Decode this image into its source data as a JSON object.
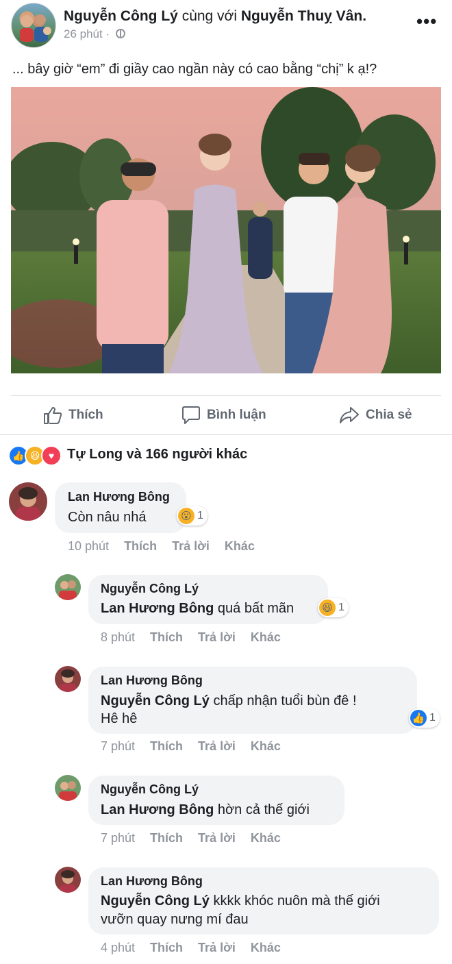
{
  "post": {
    "author": "Nguyễn Công Lý",
    "with_word": "cùng với",
    "tagged": "Nguyễn Thuỵ Vân.",
    "time": "26 phút",
    "privacy_icon": "globe-icon",
    "more_label": "•••",
    "caption": "... bây giờ “em” đi giầy cao ngần này có cao bằng “chị” k ạ!?"
  },
  "actions": {
    "like": "Thích",
    "comment": "Bình luận",
    "share": "Chia sẻ"
  },
  "reactions": {
    "icons": [
      "like-icon",
      "haha-icon",
      "love-icon"
    ],
    "summary": "Tự Long và 166 người khác"
  },
  "comments": [
    {
      "name": "Lan Hương Bông",
      "mention": "",
      "text": "Còn nâu nhá",
      "time": "10 phút",
      "like": "Thích",
      "reply": "Trả lời",
      "more": "Khác",
      "reaction_count": "1",
      "reaction_icon": "wow-icon"
    },
    {
      "name": "Nguyễn Công Lý",
      "mention": "Lan Hương Bông",
      "text": "quá bất mãn",
      "time": "8 phút",
      "like": "Thích",
      "reply": "Trả lời",
      "more": "Khác",
      "reaction_count": "1",
      "reaction_icon": "haha-icon"
    },
    {
      "name": "Lan Hương Bông",
      "mention": "Nguyễn Công Lý",
      "text": "chấp nhận tuổi bùn đê !",
      "text2": "Hê hê",
      "time": "7 phút",
      "like": "Thích",
      "reply": "Trả lời",
      "more": "Khác",
      "reaction_count": "1",
      "reaction_icon": "like-icon"
    },
    {
      "name": "Nguyễn Công Lý",
      "mention": "Lan Hương Bông",
      "text": "hờn cả thế giới",
      "time": "7 phút",
      "like": "Thích",
      "reply": "Trả lời",
      "more": "Khác"
    },
    {
      "name": "Lan Hương Bông",
      "mention": "Nguyễn Công Lý",
      "text": "kkkk khóc nuôn mà thế giới",
      "text2": "vưỡn quay nưng mí đau",
      "time": "4 phút",
      "like": "Thích",
      "reply": "Trả lời",
      "more": "Khác"
    }
  ],
  "colors": {
    "like_blue": "#1877f2",
    "haha_yellow": "#f7b125",
    "love_red": "#f33e58",
    "bubble_gray": "#f2f3f5",
    "meta_gray": "#90949c"
  }
}
